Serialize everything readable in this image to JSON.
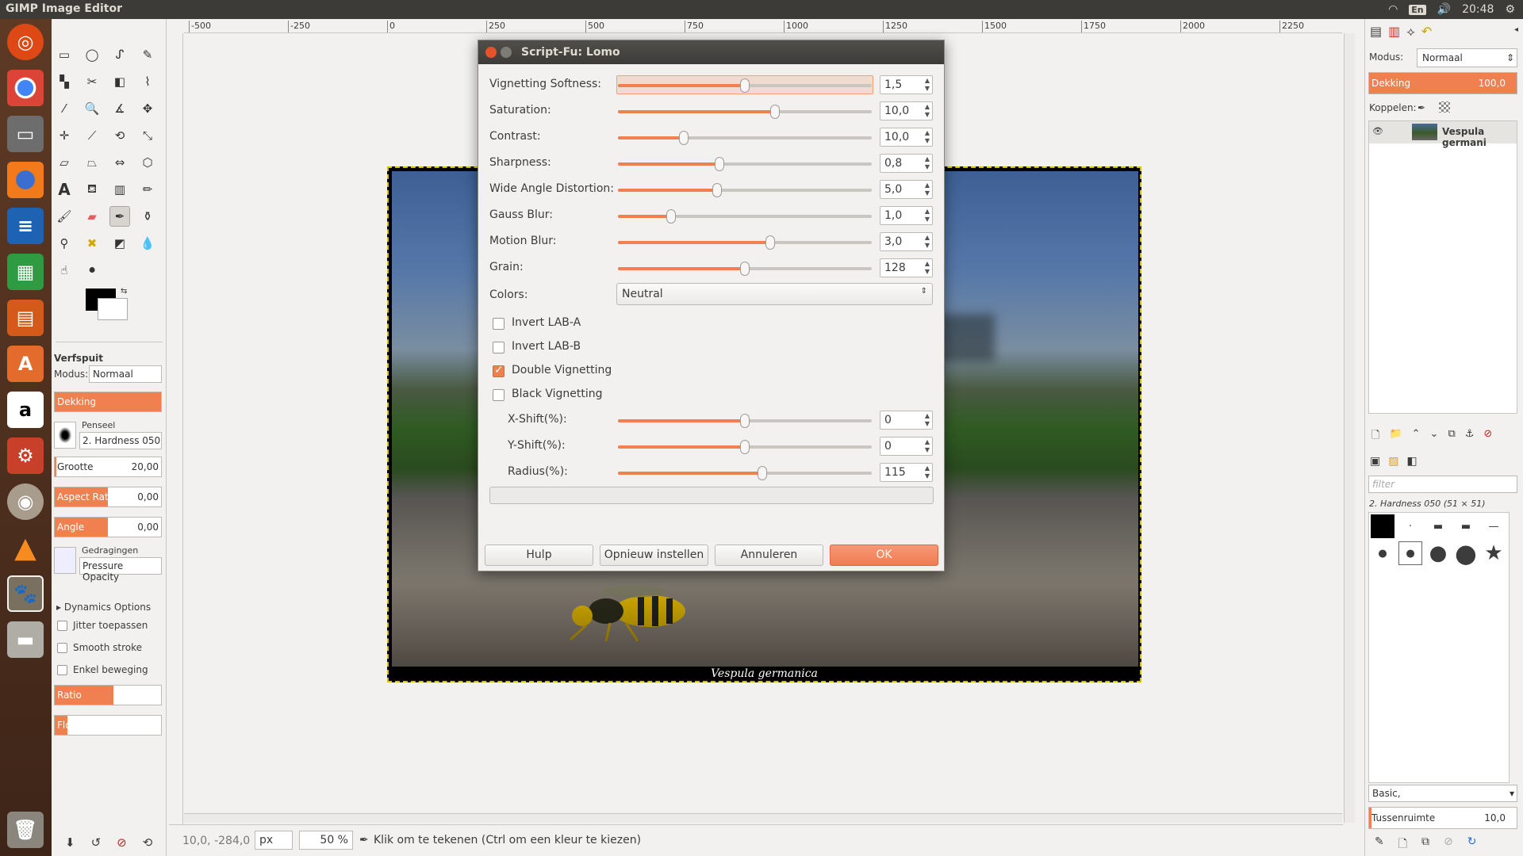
{
  "topbar": {
    "app_title": "GIMP Image Editor",
    "keyboard_layout": "En",
    "time": "20:48"
  },
  "ruler": {
    "ticks": [
      "-500",
      "-250",
      "0",
      "250",
      "500",
      "750",
      "1000",
      "1250",
      "1500",
      "1750",
      "2000",
      "2250"
    ]
  },
  "toolbox": {
    "tool_name": "Verfspuit",
    "mode_label": "Modus:",
    "mode_value": "Normaal",
    "opacity_label": "Dekking",
    "brush_label": "Penseel",
    "brush_value": "2. Hardness 050",
    "size_label": "Grootte",
    "size_value": "20,00",
    "aspect_label": "Aspect Ratio",
    "aspect_value": "0,00",
    "angle_label": "Angle",
    "angle_value": "0,00",
    "dynamics_label": "Gedragingen",
    "dynamics_value": "Pressure Opacity",
    "dynamics_options": "Dynamics Options",
    "jitter": "Jitter toepassen",
    "smooth": "Smooth stroke",
    "single": "Enkel beweging",
    "ratio": "Ratio",
    "flow": "Flow"
  },
  "image": {
    "caption": "Vespula germanica"
  },
  "status": {
    "coords": "10,0, -284,0",
    "unit": "px",
    "zoom": "50 %",
    "message": "Klik om te tekenen (Ctrl om een kleur te kiezen)"
  },
  "dialog": {
    "title": "Script-Fu: Lomo",
    "sliders": [
      {
        "label": "Vignetting Softness:",
        "value": "1,5",
        "fraction": 0.5
      },
      {
        "label": "Saturation:",
        "value": "10,0",
        "fraction": 0.62
      },
      {
        "label": "Contrast:",
        "value": "10,0",
        "fraction": 0.26
      },
      {
        "label": "Sharpness:",
        "value": "0,8",
        "fraction": 0.4
      },
      {
        "label": "Wide Angle Distortion:",
        "value": "5,0",
        "fraction": 0.39
      },
      {
        "label": "Gauss Blur:",
        "value": "1,0",
        "fraction": 0.21
      },
      {
        "label": "Motion Blur:",
        "value": "3,0",
        "fraction": 0.6
      },
      {
        "label": "Grain:",
        "value": "128",
        "fraction": 0.5
      }
    ],
    "colors_label": "Colors:",
    "colors_value": "Neutral",
    "checks": [
      {
        "label": "Invert LAB-A",
        "checked": false
      },
      {
        "label": "Invert LAB-B",
        "checked": false
      },
      {
        "label": "Double Vignetting",
        "checked": true
      },
      {
        "label": "Black Vignetting",
        "checked": false
      }
    ],
    "shift_sliders": [
      {
        "label": "X-Shift(%):",
        "value": "0",
        "fraction": 0.5
      },
      {
        "label": "Y-Shift(%):",
        "value": "0",
        "fraction": 0.5
      },
      {
        "label": "Radius(%):",
        "value": "115",
        "fraction": 0.57
      }
    ],
    "buttons": {
      "help": "Hulp",
      "reset": "Opnieuw instellen",
      "cancel": "Annuleren",
      "ok": "OK"
    }
  },
  "layers": {
    "mode_label": "Modus:",
    "mode_value": "Normaal",
    "opacity_label": "Dekking",
    "opacity_value": "100,0",
    "lock_label": "Koppelen:",
    "layer_name": "Vespula germani"
  },
  "brushes": {
    "filter_placeholder": "filter",
    "current": "2. Hardness 050 (51 × 51)",
    "preset": "Basic,",
    "spacing_label": "Tussenruimte",
    "spacing_value": "10,0"
  },
  "colors": {
    "accent": "#f08050",
    "panel": "#3c3b37",
    "launcher": "#5e3a25"
  }
}
